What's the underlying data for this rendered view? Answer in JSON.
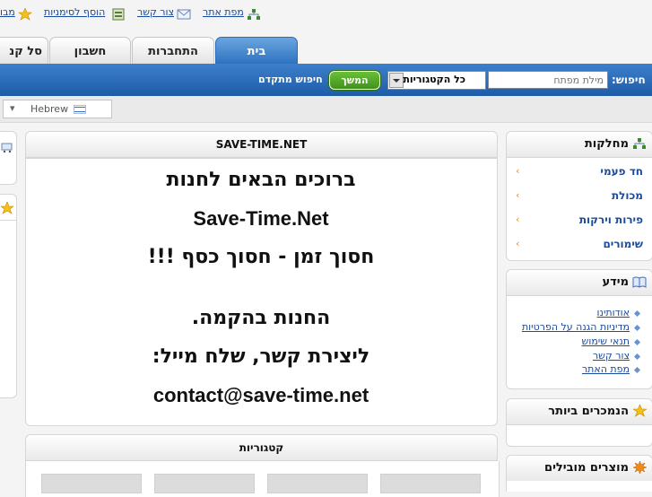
{
  "toplinks": {
    "sitemap": "מפת אתר",
    "contact": "צור קשר",
    "bookmark": "הוסף לסימניות",
    "partial": "מבו"
  },
  "tabs": [
    "בית",
    "התחברות",
    "חשבון",
    "סל קנ"
  ],
  "search": {
    "label": "חיפוש:",
    "placeholder": "מילת מפתח",
    "category": "כל הקטגוריות",
    "go": "המשך",
    "advanced": "חיפוש מתקדם"
  },
  "language": {
    "selected": "Hebrew"
  },
  "main": {
    "title": "SAVE-TIME.NET",
    "lines": [
      "ברוכים הבאים לחנות",
      "Save-Time.Net",
      "חסוך זמן - חסוך כסף !!!",
      "החנות בהקמה.",
      "ליצירת קשר, שלח מייל:",
      "contact@save-time.net"
    ],
    "categories_title": "קטגוריות"
  },
  "sidebar": {
    "departments_title": "מחלקות",
    "departments": [
      "חד פעמי",
      "מכולת",
      "פירות וירקות",
      "שימורים"
    ],
    "info_title": "מידע",
    "info": [
      "אודותינו",
      "מדיניות הגנה על הפרטיות",
      "תנאי שימוש",
      "צור קשר",
      "מפת האתר"
    ],
    "bestsellers_title": "הנמכרים ביותר",
    "featured_title": "מוצרים מובילים"
  },
  "colors": {
    "accent": "#2a6fbd",
    "link": "#1a4a9c",
    "chevron": "#e28a1a",
    "go_button": "#4a9a1e"
  }
}
